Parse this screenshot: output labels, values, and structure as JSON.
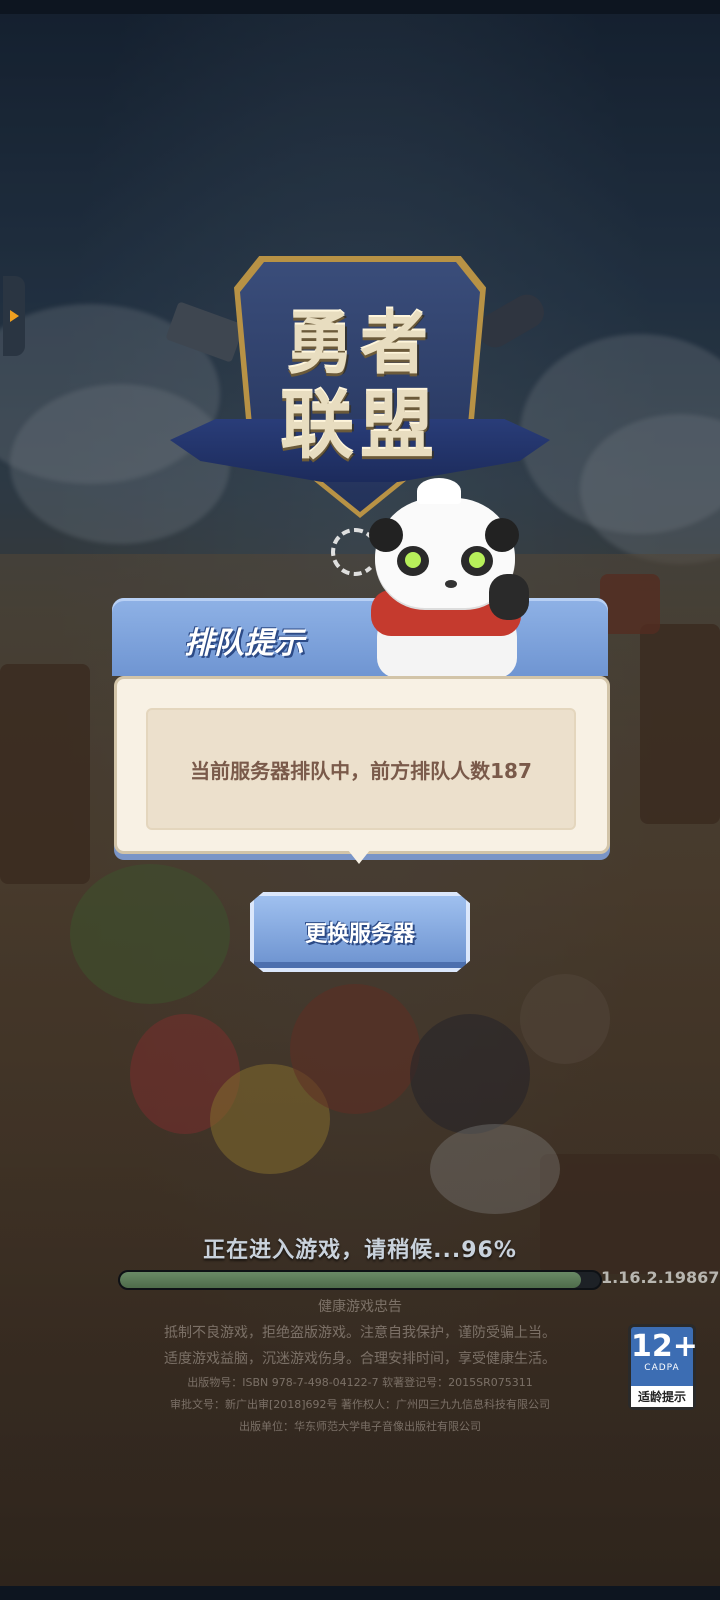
{
  "logo": {
    "line1": "勇者",
    "line2": "联盟"
  },
  "dialog": {
    "title": "排队提示",
    "message": "当前服务器排队中，前方排队人数187"
  },
  "buttons": {
    "change_server": "更换服务器"
  },
  "loading": {
    "text": "正在进入游戏，请稍候...96%",
    "progress": 0.96,
    "version": "1.16.2.19867"
  },
  "footer": {
    "health_title": "健康游戏忠告",
    "health_line1": "抵制不良游戏，拒绝盗版游戏。注意自我保护，谨防受骗上当。",
    "health_line2": "适度游戏益脑，沉迷游戏伤身。合理安排时间，享受健康生活。",
    "publication": "出版物号：ISBN 978-7-498-04122-7 软著登记号：2015SR075311",
    "approval": "审批文号：新广出审[2018]692号 著作权人：广州四三九九信息科技有限公司",
    "publisher": "出版单位：华东师范大学电子音像出版社有限公司"
  },
  "age_rating": {
    "value": "12+",
    "org": "CADPA",
    "label": "适龄提示"
  },
  "icons": {
    "side_handle": "chevron-right-icon",
    "spinner": "loading-spinner-icon"
  },
  "colors": {
    "dialog_header": "#7fa3dc",
    "dialog_body": "#f8f1e4",
    "progress_fill": "#5a7a56",
    "button": "#8ab0e8"
  }
}
